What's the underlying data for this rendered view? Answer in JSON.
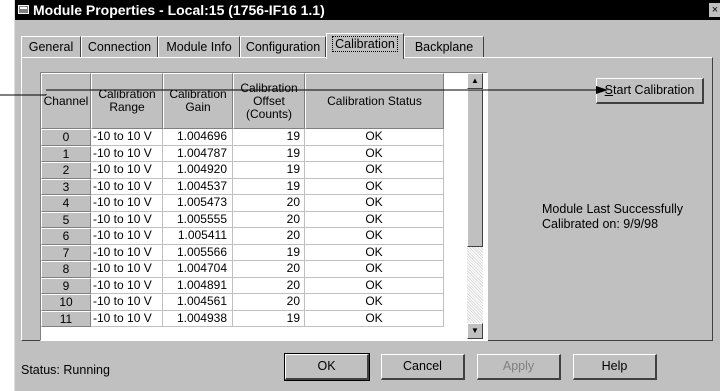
{
  "window": {
    "title": "Module Properties - Local:15 (1756-IF16 1.1)",
    "close_glyph": "×",
    "sysmenu_icon": "window-menu-icon",
    "close_icon": "close-icon"
  },
  "tabs": [
    {
      "label": "General",
      "active": false
    },
    {
      "label": "Connection",
      "active": false
    },
    {
      "label": "Module Info",
      "active": false
    },
    {
      "label": "Configuration",
      "active": false
    },
    {
      "label": "Calibration",
      "active": true
    },
    {
      "label": "Backplane",
      "active": false
    }
  ],
  "table": {
    "headers": [
      "Channel",
      "Calibration Range",
      "Calibration Gain",
      "Calibration Offset (Counts)",
      "Calibration Status"
    ],
    "rows": [
      {
        "channel": "0",
        "range": "-10 to 10 V",
        "gain": "1.004696",
        "offset": "19",
        "status": "OK"
      },
      {
        "channel": "1",
        "range": "-10 to 10 V",
        "gain": "1.004787",
        "offset": "19",
        "status": "OK"
      },
      {
        "channel": "2",
        "range": "-10 to 10 V",
        "gain": "1.004920",
        "offset": "19",
        "status": "OK"
      },
      {
        "channel": "3",
        "range": "-10 to 10 V",
        "gain": "1.004537",
        "offset": "19",
        "status": "OK"
      },
      {
        "channel": "4",
        "range": "-10 to 10 V",
        "gain": "1.005473",
        "offset": "20",
        "status": "OK"
      },
      {
        "channel": "5",
        "range": "-10 to 10 V",
        "gain": "1.005555",
        "offset": "20",
        "status": "OK"
      },
      {
        "channel": "6",
        "range": "-10 to 10 V",
        "gain": "1.005411",
        "offset": "20",
        "status": "OK"
      },
      {
        "channel": "7",
        "range": "-10 to 10 V",
        "gain": "1.005566",
        "offset": "19",
        "status": "OK"
      },
      {
        "channel": "8",
        "range": "-10 to 10 V",
        "gain": "1.004704",
        "offset": "20",
        "status": "OK"
      },
      {
        "channel": "9",
        "range": "-10 to 10 V",
        "gain": "1.004891",
        "offset": "20",
        "status": "OK"
      },
      {
        "channel": "10",
        "range": "-10 to 10 V",
        "gain": "1.004561",
        "offset": "20",
        "status": "OK"
      },
      {
        "channel": "11",
        "range": "-10 to 10 V",
        "gain": "1.004938",
        "offset": "19",
        "status": "OK"
      }
    ]
  },
  "scrollbar": {
    "up_glyph": "▲",
    "down_glyph": "▼"
  },
  "start_calibration": {
    "label_prefix": "",
    "label_mnemonic": "S",
    "label_rest": "tart Calibration"
  },
  "module_info": {
    "line1": "Module Last Successfully",
    "line2": "Calibrated on:  9/9/98"
  },
  "status": {
    "text": "Status:  Running"
  },
  "buttons": {
    "ok": "OK",
    "cancel": "Cancel",
    "apply": "Apply",
    "help": "Help"
  },
  "colors": {
    "face": "#c0c0c0",
    "titlebar": "#000000",
    "disabled_text": "#808080"
  }
}
